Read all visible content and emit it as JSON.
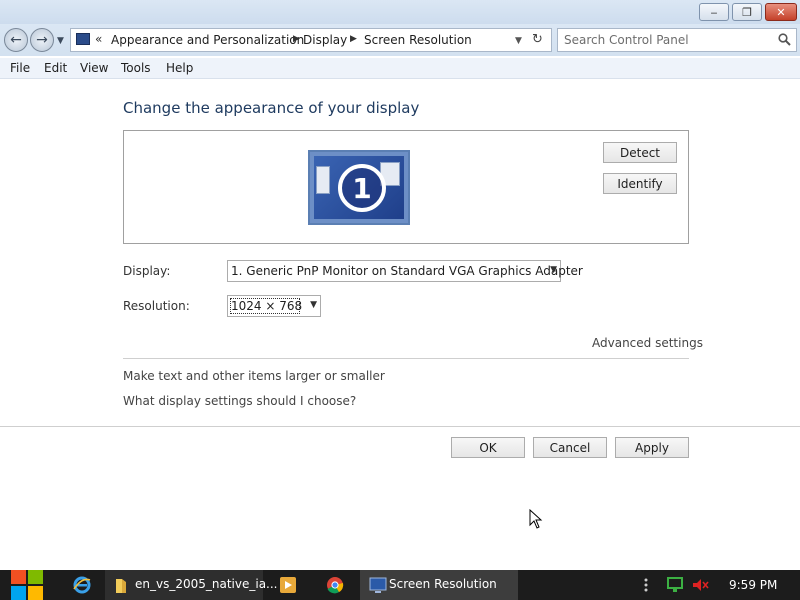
{
  "window": {
    "minimize_glyph": "‒",
    "maximize_glyph": "❐",
    "close_glyph": "✕"
  },
  "address": {
    "breadcrumbs": [
      "Appearance and Personalization",
      "Display",
      "Screen Resolution"
    ],
    "search_placeholder": "Search Control Panel"
  },
  "menu": [
    "File",
    "Edit",
    "View",
    "Tools",
    "Help"
  ],
  "content": {
    "heading": "Change the appearance of your display",
    "monitor_number": "1",
    "detect_label": "Detect",
    "identify_label": "Identify",
    "display_label": "Display:",
    "display_value": "1. Generic PnP Monitor on Standard VGA Graphics Adapter",
    "resolution_label": "Resolution:",
    "resolution_value": "1024 × 768",
    "advanced_label": "Advanced settings",
    "link_text_size": "Make text and other items larger or smaller",
    "link_choose": "What display settings should I choose?",
    "ok_label": "OK",
    "cancel_label": "Cancel",
    "apply_label": "Apply"
  },
  "taskbar": {
    "items": [
      {
        "label": "en_vs_2005_native_ia...",
        "icon": "folder-icon"
      },
      {
        "label": "Screen Resolution",
        "icon": "control-panel-icon"
      }
    ],
    "clock": "9:59 PM"
  },
  "colors": {
    "titlebar": "#dbe7f4",
    "heading": "#1e3a5f",
    "taskbar": "#1c1c1c",
    "close_button": "#c4412a"
  }
}
